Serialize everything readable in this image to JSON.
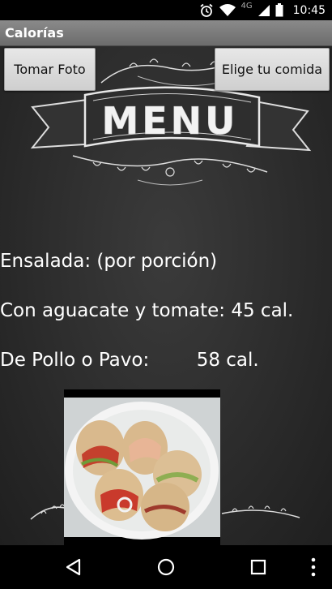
{
  "status_bar": {
    "time": "10:45",
    "network_label": "4G"
  },
  "title_bar": {
    "title": "Calorías"
  },
  "buttons": {
    "take_photo": "Tomar Foto",
    "choose_food": "Elige tu comida"
  },
  "menu_banner": {
    "text": "MENU"
  },
  "lines": {
    "heading": "Ensalada: (por porción)",
    "item1": "Con aguacate y tomate: 45 cal.",
    "item2": "De Pollo o Pavo:        58 cal."
  },
  "navigation": [
    "back-icon",
    "home-icon",
    "recents-icon",
    "more-options-icon"
  ]
}
